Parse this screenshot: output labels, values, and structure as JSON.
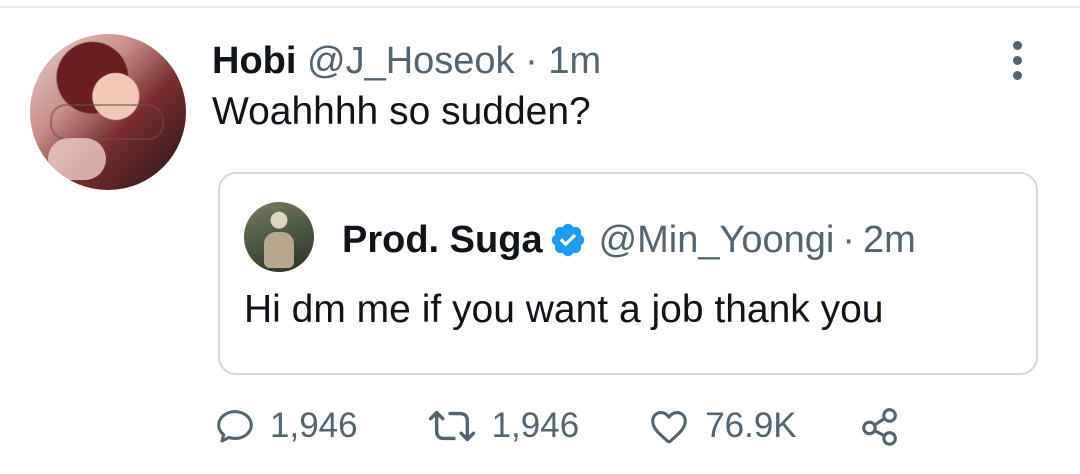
{
  "tweet": {
    "author_name": "Hobi",
    "author_handle": "@J_Hoseok",
    "separator": "·",
    "time": "1m",
    "text": "Woahhhh so sudden?"
  },
  "quoted_tweet": {
    "author_name": "Prod. Suga",
    "author_handle": "@Min_Yoongi",
    "separator": "·",
    "time": "2m",
    "text": "Hi dm me if you want a job thank you",
    "verified_color": "#1d9bf0"
  },
  "actions": {
    "reply_count": "1,946",
    "retweet_count": "1,946",
    "like_count": "76.9K"
  },
  "icons": {
    "more": "more-vertical-icon",
    "reply": "reply-icon",
    "retweet": "retweet-icon",
    "like": "heart-icon",
    "share": "share-icon",
    "verified": "verified-badge-icon"
  },
  "colors": {
    "text": "#0f1419",
    "secondary": "#536471",
    "border": "#cfd9de",
    "verified": "#1d9bf0"
  }
}
